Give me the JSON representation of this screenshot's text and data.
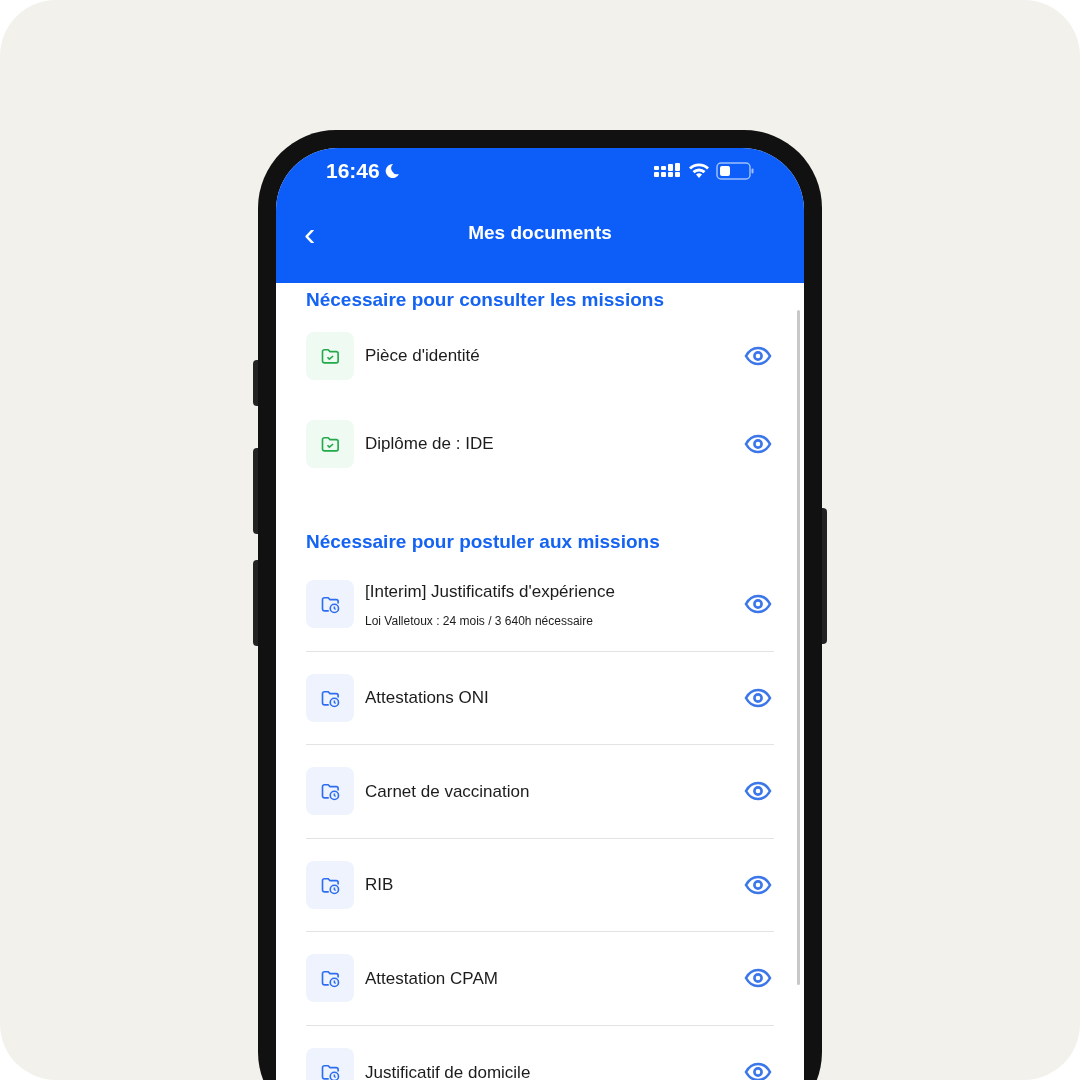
{
  "status_bar": {
    "time": "16:46"
  },
  "header": {
    "back": "‹",
    "title": "Mes documents"
  },
  "sections": [
    {
      "title": "Nécessaire pour consulter les missions",
      "dividers": false,
      "items": [
        {
          "label": "Pièce d'identité",
          "kind": "validated"
        },
        {
          "label": "Diplôme de : IDE",
          "kind": "validated"
        }
      ]
    },
    {
      "title": "Nécessaire pour postuler aux missions",
      "dividers": true,
      "items": [
        {
          "label": "[Interim] Justificatifs d'expérience",
          "subtitle": "Loi Valletoux : 24 mois / 3 640h nécessaire",
          "kind": "pending"
        },
        {
          "label": "Attestations ONI",
          "kind": "pending"
        },
        {
          "label": "Carnet de vaccination",
          "kind": "pending"
        },
        {
          "label": "RIB",
          "kind": "pending"
        },
        {
          "label": "Attestation CPAM",
          "kind": "pending"
        },
        {
          "label": "Justificatif de domicile",
          "kind": "pending"
        }
      ]
    }
  ]
}
